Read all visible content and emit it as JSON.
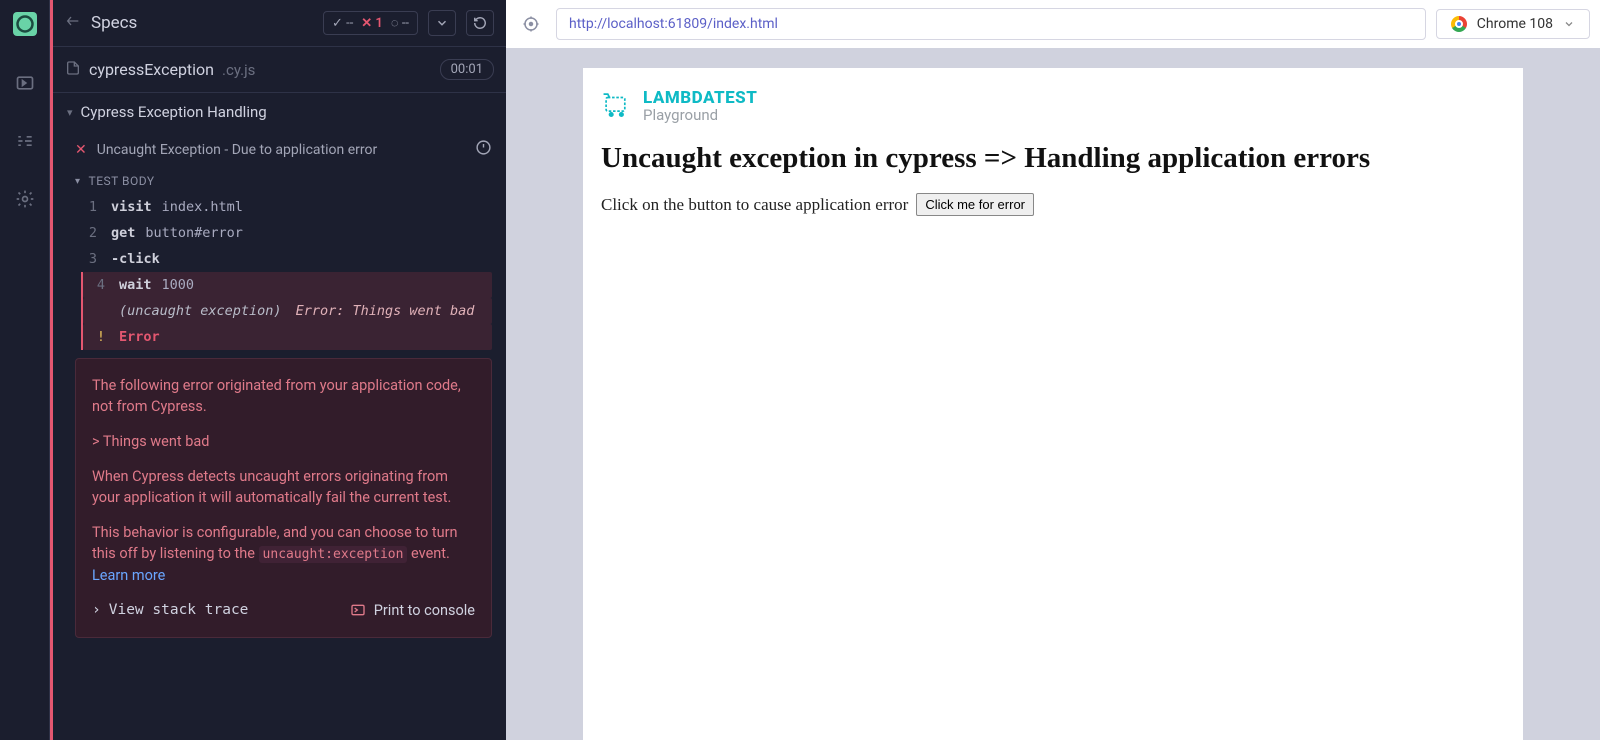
{
  "header": {
    "title": "Specs"
  },
  "stats": {
    "passed": "--",
    "failed": "1",
    "pending": "--"
  },
  "file": {
    "name": "cypressException",
    "ext": ".cy.js",
    "time": "00:01"
  },
  "suite": {
    "name": "Cypress Exception Handling"
  },
  "test": {
    "name": "Uncaught Exception - Due to application error"
  },
  "body_label": "TEST BODY",
  "commands": [
    {
      "n": "1",
      "k": "visit",
      "a": "index.html"
    },
    {
      "n": "2",
      "k": "get",
      "a": "button#error"
    },
    {
      "n": "3",
      "k": "-click",
      "a": ""
    },
    {
      "n": "4",
      "k": "wait",
      "a": "1000"
    }
  ],
  "exception": {
    "label": "(uncaught exception)",
    "msg": "Error: Things went bad"
  },
  "errorline": {
    "n": "!",
    "k": "Error"
  },
  "errbox": {
    "p1": "The following error originated from your application code, not from Cypress.",
    "p2": "> Things went bad",
    "p3": "When Cypress detects uncaught errors originating from your application it will automatically fail the current test.",
    "p4a": "This behavior is configurable, and you can choose to turn this off by listening to the ",
    "code": "uncaught:exception",
    "p4b": " event. ",
    "learn": "Learn more",
    "stack": "View stack trace",
    "print": "Print to console"
  },
  "aut": {
    "url": "http://localhost:61809/index.html",
    "browser": "Chrome 108",
    "logo1": "LAMBDATEST",
    "logo2": "Playground",
    "h1": "Uncaught exception in cypress => Handling application errors",
    "prompt": "Click on the button to cause application error",
    "button": "Click me for error"
  }
}
